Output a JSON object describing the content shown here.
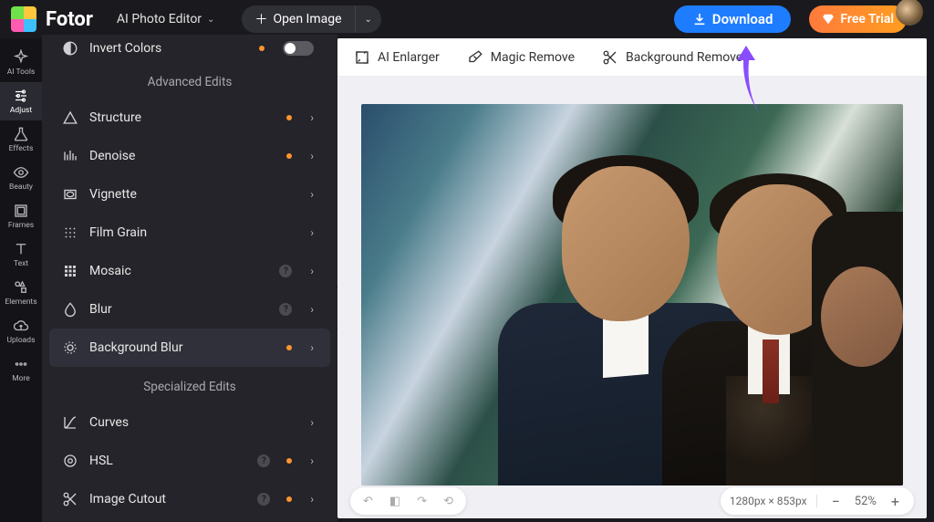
{
  "brand": "Fotor",
  "header": {
    "mode_label": "AI Photo Editor",
    "open_image": "Open Image",
    "download": "Download",
    "free_trial": "Free Trial"
  },
  "rail": [
    {
      "id": "ai-tools",
      "label": "AI Tools"
    },
    {
      "id": "adjust",
      "label": "Adjust"
    },
    {
      "id": "effects",
      "label": "Effects"
    },
    {
      "id": "beauty",
      "label": "Beauty"
    },
    {
      "id": "frames",
      "label": "Frames"
    },
    {
      "id": "text",
      "label": "Text"
    },
    {
      "id": "elements",
      "label": "Elements"
    },
    {
      "id": "uploads",
      "label": "Uploads"
    },
    {
      "id": "more",
      "label": "More"
    }
  ],
  "panel": {
    "invert": "Invert Colors",
    "section_advanced": "Advanced Edits",
    "section_specialized": "Specialized Edits",
    "items": [
      {
        "label": "Structure",
        "dot": true,
        "help": false
      },
      {
        "label": "Denoise",
        "dot": true,
        "help": false
      },
      {
        "label": "Vignette",
        "dot": false,
        "help": false
      },
      {
        "label": "Film Grain",
        "dot": false,
        "help": false
      },
      {
        "label": "Mosaic",
        "dot": false,
        "help": true
      },
      {
        "label": "Blur",
        "dot": false,
        "help": true
      },
      {
        "label": "Background Blur",
        "dot": true,
        "help": false,
        "selected": true
      }
    ],
    "specialized": [
      {
        "label": "Curves",
        "dot": false,
        "help": false
      },
      {
        "label": "HSL",
        "dot": true,
        "help": true
      },
      {
        "label": "Image Cutout",
        "dot": true,
        "help": true
      }
    ]
  },
  "toolbar": {
    "enlarger": "AI Enlarger",
    "magic_remove": "Magic Remove",
    "bg_remove": "Background Remover"
  },
  "status": {
    "dimensions": "1280px × 853px",
    "zoom": "52%"
  },
  "colors": {
    "accent": "#1e7cff",
    "trial": "#ff8a2c",
    "dot": "#ff9430"
  }
}
